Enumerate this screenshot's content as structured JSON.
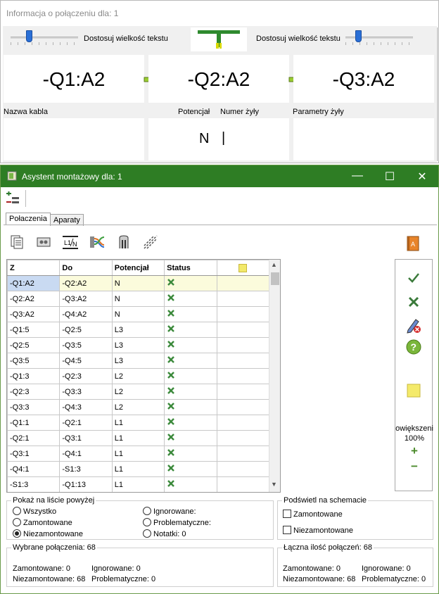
{
  "info_window": {
    "title": "Informacja o połączeniu dla: 1",
    "adjust_text_left": "Dostosuj wielkość tekstu",
    "adjust_text_right": "Dostosuj wielkość tekstu",
    "from": "-Q1:A2",
    "mid": "-Q2:A2",
    "to": "-Q3:A2",
    "cable_name_label": "Nazwa kabla",
    "potential_label": "Potencjał",
    "wire_number_label": "Numer żyły",
    "wire_params_label": "Parametry żyły",
    "potential_value": "N",
    "cursor": "|"
  },
  "assistant_window": {
    "title": "Asystent montażowy dla: 1",
    "tabs": [
      "Połaczenia",
      "Aparaty"
    ],
    "columns": [
      "Z",
      "Do",
      "Potencjał",
      "Status",
      ""
    ],
    "rows": [
      [
        "-Q1:A2",
        "-Q2:A2",
        "N"
      ],
      [
        "-Q2:A2",
        "-Q3:A2",
        "N"
      ],
      [
        "-Q3:A2",
        "-Q4:A2",
        "N"
      ],
      [
        "-Q1:5",
        "-Q2:5",
        "L3"
      ],
      [
        "-Q2:5",
        "-Q3:5",
        "L3"
      ],
      [
        "-Q3:5",
        "-Q4:5",
        "L3"
      ],
      [
        "-Q1:3",
        "-Q2:3",
        "L2"
      ],
      [
        "-Q2:3",
        "-Q3:3",
        "L2"
      ],
      [
        "-Q3:3",
        "-Q4:3",
        "L2"
      ],
      [
        "-Q1:1",
        "-Q2:1",
        "L1"
      ],
      [
        "-Q2:1",
        "-Q3:1",
        "L1"
      ],
      [
        "-Q3:1",
        "-Q4:1",
        "L1"
      ],
      [
        "-Q4:1",
        "-S1:3",
        "L1"
      ],
      [
        "-S1:3",
        "-Q1:13",
        "L1"
      ]
    ],
    "zoom_label": "owiększeni",
    "zoom_value": "100%",
    "zoom_in": "+",
    "zoom_out": "−",
    "show_group": {
      "title": "Pokaż na liście powyżej",
      "options": [
        "Wszystko",
        "Zamontowane",
        "Niezamontowane",
        "Ignorowane:",
        "Problematyczne:",
        "Notatki: 0"
      ]
    },
    "highlight_group": {
      "title": "Podświetl na schemacie",
      "options": [
        "Zamontowane",
        "Niezamontowane"
      ]
    },
    "selected_group": {
      "title": "Wybrane połączenia: 68",
      "mounted": "Zamontowane: 0",
      "ignored": "Ignorowane: 0",
      "unmounted": "Niezamontowane: 68",
      "problematic": "Problematyczne: 0"
    },
    "total_group": {
      "title": "Łączna ilość połączeń: 68",
      "mounted": "Zamontowane: 0",
      "ignored": "Ignorowane: 0",
      "unmounted": "Niezamontowane: 68",
      "problematic": "Problematyczne: 0"
    },
    "colors": {
      "titlebar": "#2e7d24",
      "status_x": "#3c8a3c",
      "selected_row": "#fbfbdc"
    }
  }
}
